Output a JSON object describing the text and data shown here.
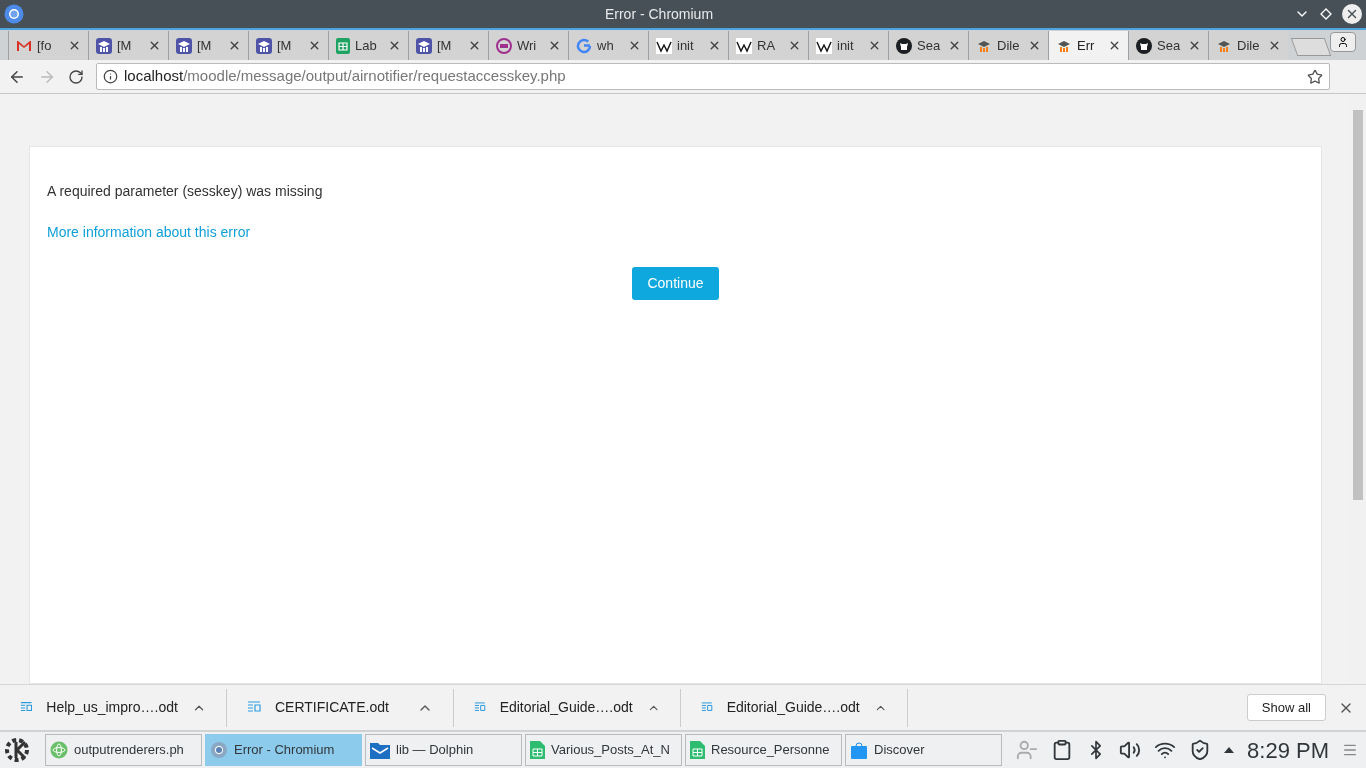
{
  "window": {
    "title": "Error - Chromium"
  },
  "tabs": [
    {
      "label": "[fo",
      "kind": "mail",
      "selected": false
    },
    {
      "label": "[M",
      "kind": "cap-purple",
      "selected": false
    },
    {
      "label": "[M",
      "kind": "cap-purple",
      "selected": false
    },
    {
      "label": "[M",
      "kind": "cap-purple",
      "selected": false
    },
    {
      "label": "Lab",
      "kind": "sheet",
      "selected": false
    },
    {
      "label": "[M",
      "kind": "cap-purple",
      "selected": false
    },
    {
      "label": "Wri",
      "kind": "ring",
      "selected": false
    },
    {
      "label": "wh",
      "kind": "google",
      "selected": false
    },
    {
      "label": "init",
      "kind": "wiki",
      "selected": false
    },
    {
      "label": "RA",
      "kind": "wiki",
      "selected": false
    },
    {
      "label": "init",
      "kind": "wiki",
      "selected": false
    },
    {
      "label": "Sea",
      "kind": "octocat",
      "selected": false
    },
    {
      "label": "Dile",
      "kind": "cap-orange",
      "selected": false
    },
    {
      "label": "Err",
      "kind": "cap-orange",
      "selected": true
    },
    {
      "label": "Sea",
      "kind": "octocat",
      "selected": false
    },
    {
      "label": "Dile",
      "kind": "cap-orange",
      "selected": false
    }
  ],
  "address": {
    "host": "localhost",
    "path": "/moodle/message/output/airnotifier/requestaccesskey.php"
  },
  "page": {
    "message": "A required parameter (sesskey) was missing",
    "link": "More information about this error",
    "button": "Continue"
  },
  "downloads": [
    "Help_us_impro….odt",
    "CERTIFICATE.odt",
    "Editorial_Guide….odt",
    "Editorial_Guide….odt"
  ],
  "show_all": "Show all",
  "taskbar": [
    {
      "label": "outputrenderers.ph",
      "kind": "atom",
      "selected": false
    },
    {
      "label": "Error - Chromium",
      "kind": "chromium",
      "selected": true
    },
    {
      "label": "lib — Dolphin",
      "kind": "folder",
      "selected": false
    },
    {
      "label": "Various_Posts_At_N",
      "kind": "sheet",
      "selected": false
    },
    {
      "label": "Resource_Personne",
      "kind": "sheet",
      "selected": false
    },
    {
      "label": "Discover",
      "kind": "bag",
      "selected": false
    }
  ],
  "clock": "8:29 PM"
}
